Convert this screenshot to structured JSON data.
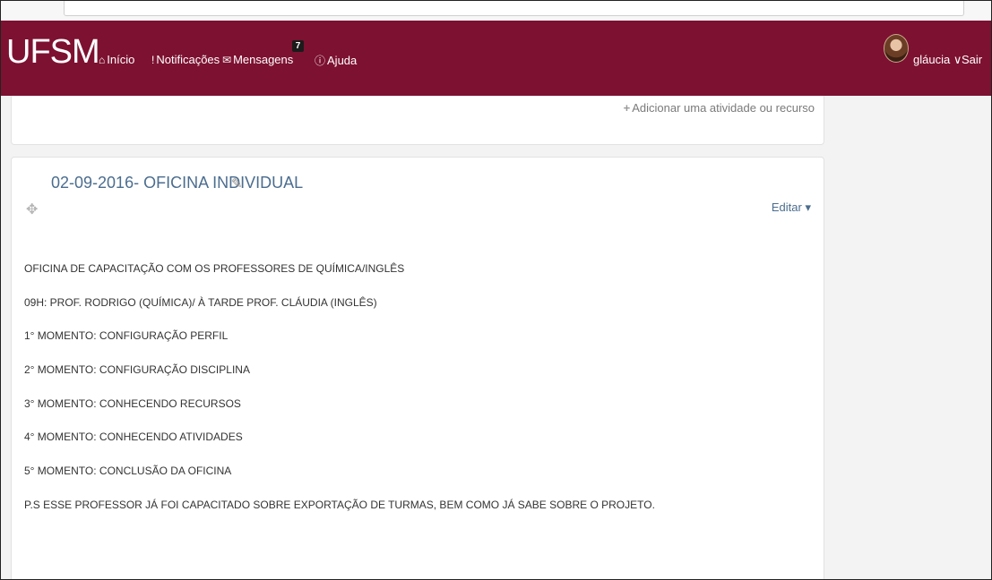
{
  "navbar": {
    "brand": "UFSM",
    "links": [
      {
        "icon": "home-icon",
        "glyph": "⌂",
        "label": "Início"
      },
      {
        "icon": "exclamation-icon",
        "glyph": "!",
        "label": "Notificações"
      },
      {
        "icon": "envelope-icon",
        "glyph": "✉",
        "label": "Mensagens"
      },
      {
        "icon": "help-circle-icon",
        "glyph": "ⓘ",
        "label": "Ajuda"
      }
    ],
    "messages_badge": "7",
    "user_name": "gláucia",
    "user_caret": "∨",
    "logout_label": "Sair"
  },
  "previous_section": {
    "add_activity_label": "Adicionar uma atividade ou recurso"
  },
  "section": {
    "title": "02-09-2016- OFICINA INDIVIDUAL",
    "edit_label": "Editar",
    "edit_caret": "▾",
    "summary_lines": [
      "OFICINA DE CAPACITAÇÃO COM OS PROFESSORES DE QUÍMICA/INGLÊS",
      "09H: PROF. RODRIGO (QUÍMICA)/ À TARDE PROF. CLÁUDIA (INGLÊS)",
      "1° MOMENTO: CONFIGURAÇÃO PERFIL",
      "2° MOMENTO: CONFIGURAÇÃO DISCIPLINA",
      "3° MOMENTO: CONHECENDO RECURSOS",
      "4° MOMENTO: CONHECENDO ATIVIDADES",
      "5° MOMENTO: CONCLUSÃO DA OFICINA",
      "P.S ESSE PROFESSOR JÁ FOI CAPACITADO SOBRE EXPORTAÇÃO DE TURMAS, BEM COMO JÁ SABE SOBRE O PROJETO."
    ]
  },
  "colors": {
    "navbar_bg": "#7d1131",
    "link_blue": "#4b6d8f"
  }
}
